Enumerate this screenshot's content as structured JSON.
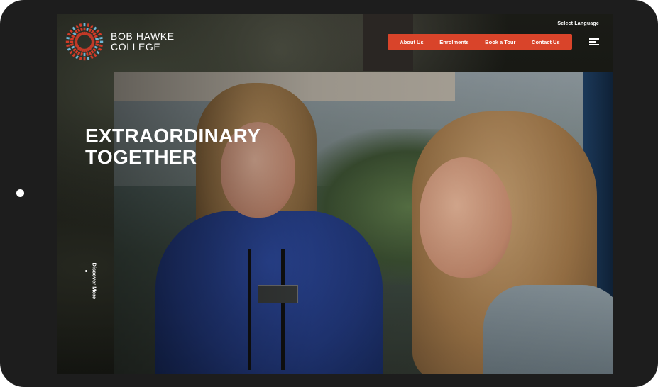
{
  "brand": {
    "name_line1": "BOB HAWKE",
    "name_line2": "COLLEGE",
    "logo_icon": "radial-burst-logo",
    "colors": {
      "accent": "#d9442a",
      "logo_red": "#d23b28",
      "logo_blue": "#6fb7d6"
    }
  },
  "header": {
    "language_label": "Select Language",
    "nav": [
      {
        "label": "About Us"
      },
      {
        "label": "Enrolments"
      },
      {
        "label": "Book a Tour"
      },
      {
        "label": "Contact Us"
      }
    ],
    "menu_icon": "hamburger-icon"
  },
  "hero": {
    "title_line1": "EXTRAORDINARY",
    "title_line2": "TOGETHER",
    "discover_label": "Discover More"
  }
}
